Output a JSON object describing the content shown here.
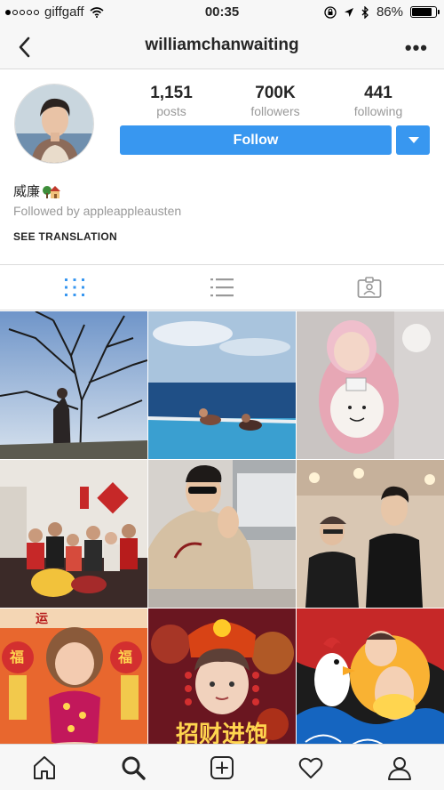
{
  "status_bar": {
    "carrier": "giffgaff",
    "time": "00:35",
    "battery": "86%",
    "battery_level": 0.86
  },
  "nav": {
    "title": "williamchanwaiting",
    "back_icon": "chevron-left-icon",
    "more_icon": "more-options-icon"
  },
  "profile": {
    "stats": [
      {
        "value": "1,151",
        "label": "posts"
      },
      {
        "value": "700K",
        "label": "followers"
      },
      {
        "value": "441",
        "label": "following"
      }
    ],
    "follow_label": "Follow",
    "name": "威廉",
    "name_emoji": "house-with-garden-icon",
    "followed_by": "Followed by appleappleausten",
    "see_translation": "SEE TRANSLATION"
  },
  "tabs": [
    {
      "name": "grid-view",
      "icon": "grid-icon",
      "active": true
    },
    {
      "name": "list-view",
      "icon": "list-icon",
      "active": false
    },
    {
      "name": "tagged",
      "icon": "tagged-photos-icon",
      "active": false
    }
  ],
  "posts": [
    {
      "caption": "",
      "texts": []
    },
    {
      "caption": "",
      "texts": []
    },
    {
      "caption": "",
      "texts": []
    },
    {
      "caption": "",
      "texts": []
    },
    {
      "caption": "",
      "texts": []
    },
    {
      "caption": "",
      "texts": []
    },
    {
      "caption": "",
      "texts": [
        "运",
        "福",
        "福"
      ]
    },
    {
      "caption": "",
      "texts": [
        "招财进饱"
      ]
    },
    {
      "caption": "",
      "texts": []
    }
  ],
  "tabbar": [
    {
      "name": "home",
      "icon": "home-icon"
    },
    {
      "name": "search",
      "icon": "search-icon",
      "active": true
    },
    {
      "name": "new-post",
      "icon": "add-post-icon"
    },
    {
      "name": "activity",
      "icon": "heart-icon"
    },
    {
      "name": "profile",
      "icon": "profile-icon"
    }
  ],
  "colors": {
    "accent": "#3897f0",
    "active_tab": "#3897f0",
    "muted": "#999999",
    "border": "#dbdbdb"
  }
}
